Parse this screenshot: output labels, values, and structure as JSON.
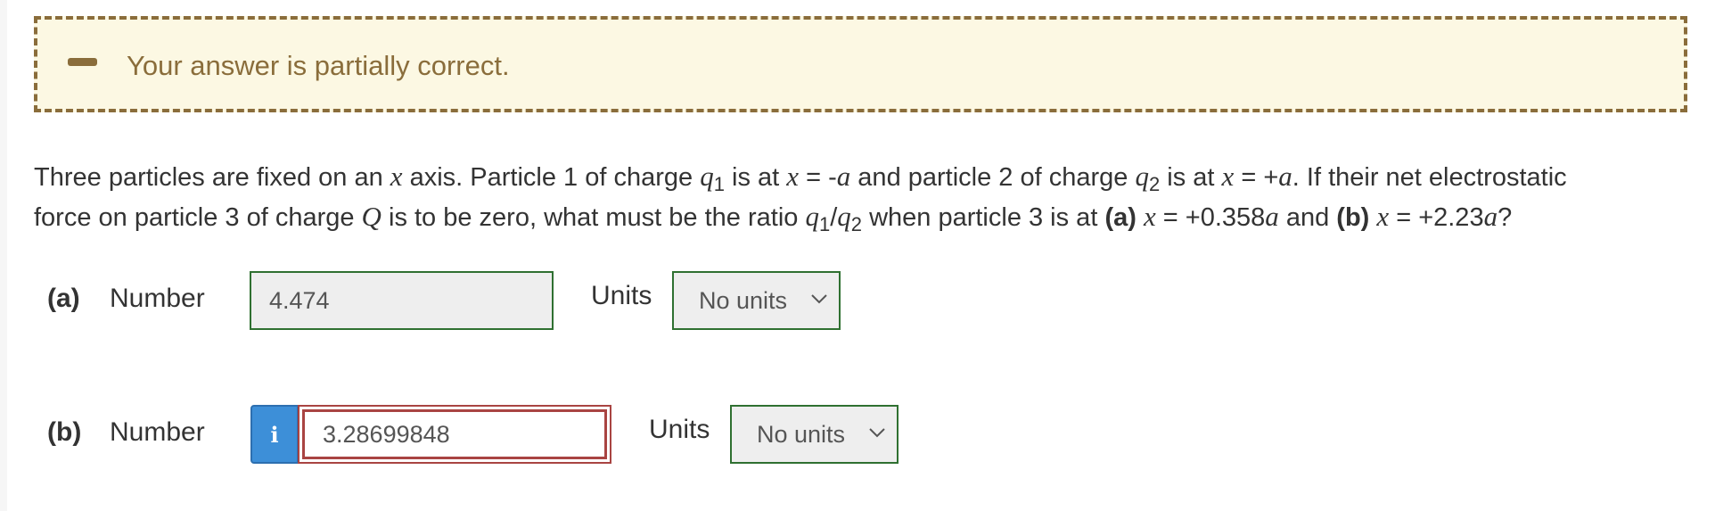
{
  "feedback": {
    "icon": "minus-icon",
    "message": "Your answer is partially correct.",
    "color": "#8a6d3b",
    "background": "#fcf8e3"
  },
  "question": {
    "line1": {
      "t1": "Three particles are fixed on an ",
      "x1": "x",
      "t2": " axis. Particle 1 of charge ",
      "q1": "q",
      "q1sub": "1",
      "t3": " is at ",
      "x2": "x",
      "t4": " = -",
      "a1": "a",
      "t5": " and particle 2 of charge ",
      "q2": "q",
      "q2sub": "2",
      "t6": " is at ",
      "x3": "x",
      "t7": " = +",
      "a2": "a",
      "t8": ". If their net electrostatic"
    },
    "line2": {
      "t1": "force on particle 3 of charge ",
      "Q": "Q",
      "t2": " is to be zero, what must be the ratio ",
      "q1": "q",
      "q1sub": "1",
      "slash": "/",
      "q2": "q",
      "q2sub": "2",
      "t3": " when particle 3 is at ",
      "pa": "(a)",
      "t4": " ",
      "x1": "x",
      "t5": " = +0.358",
      "a1": "a",
      "t6": " and ",
      "pb": "(b)",
      "t7": " ",
      "x2": "x",
      "t8": " = +2.23",
      "a2": "a",
      "t9": "?"
    }
  },
  "parts": [
    {
      "label": "(a)",
      "number_label": "Number",
      "value": "4.474",
      "status": "correct",
      "units_label": "Units",
      "units_value": "No units"
    },
    {
      "label": "(b)",
      "number_label": "Number",
      "info_icon": "i",
      "value": "3.28699848",
      "status": "incorrect",
      "units_label": "Units",
      "units_value": "No units"
    }
  ],
  "colors": {
    "correct_border": "#2f7031",
    "incorrect_border": "#a94442",
    "info_button": "#3d8fd8"
  }
}
